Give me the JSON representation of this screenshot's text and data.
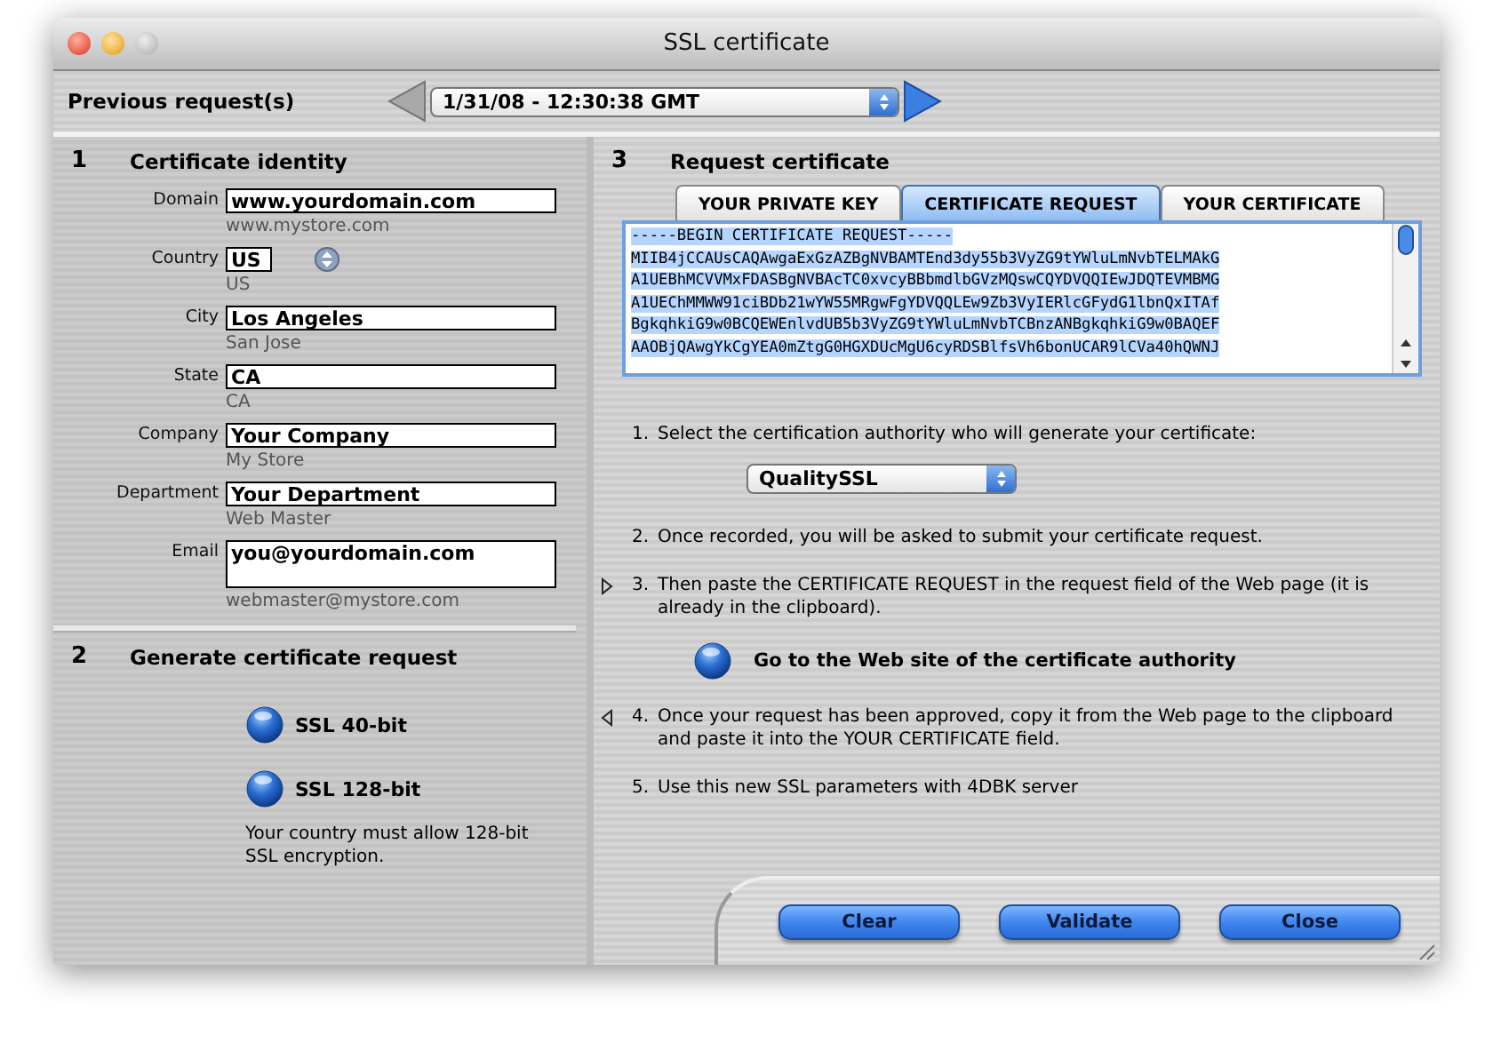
{
  "window": {
    "title": "SSL certificate"
  },
  "previous_requests": {
    "label": "Previous request(s)",
    "value": "1/31/08 - 12:30:38 GMT"
  },
  "identity": {
    "number": "1",
    "title": "Certificate identity",
    "fields": [
      {
        "label": "Domain",
        "value": "www.yourdomain.com",
        "example": "www.mystore.com",
        "kind": "text"
      },
      {
        "label": "Country",
        "value": "US",
        "example": "US",
        "kind": "stepper"
      },
      {
        "label": "City",
        "value": "Los Angeles",
        "example": "San Jose",
        "kind": "text"
      },
      {
        "label": "State",
        "value": "CA",
        "example": "CA",
        "kind": "text"
      },
      {
        "label": "Company",
        "value": "Your Company",
        "example": "My Store",
        "kind": "text"
      },
      {
        "label": "Department",
        "value": "Your Department",
        "example": "Web Master",
        "kind": "text"
      },
      {
        "label": "Email",
        "value": "you@yourdomain.com",
        "example": "webmaster@mystore.com",
        "kind": "multiline"
      }
    ]
  },
  "generate": {
    "number": "2",
    "title": "Generate certificate request",
    "options": [
      "SSL 40-bit",
      "SSL 128-bit"
    ],
    "note": "Your country must allow 128-bit SSL encryption."
  },
  "request": {
    "number": "3",
    "title": "Request certificate",
    "tabs": [
      {
        "label": "YOUR PRIVATE KEY",
        "selected": false
      },
      {
        "label": "CERTIFICATE REQUEST",
        "selected": true
      },
      {
        "label": "YOUR CERTIFICATE",
        "selected": false
      }
    ],
    "certificate_lines": [
      "-----BEGIN CERTIFICATE REQUEST-----",
      "MIIB4jCCAUsCAQAwgaExGzAZBgNVBAMTEnd3dy55b3VyZG9tYWluLmNvbTELMAkG",
      "A1UEBhMCVVMxFDASBgNVBAcTC0xvcyBBbmdlbGVzMQswCQYDVQQIEwJDQTEVMBMG",
      "A1UEChMMWW91ciBDb21wYW55MRgwFgYDVQQLEw9Zb3VyIERlcGFydG1lbnQxITAf",
      "BgkqhkiG9w0BCQEWEnlvdUB5b3VyZG9tYWluLmNvbTCBnzANBgkqhkiG9w0BAQEF",
      "AAOBjQAwgYkCgYEA0mZtgG0HGXDUcMgU6cyRDSBlfsVh6bonUCAR9lCVa40hQWNJ"
    ],
    "steps": [
      {
        "number": "1.",
        "text": "Select the certification authority who will generate your certificate:",
        "forward_marker": false,
        "back_marker": false,
        "select": "QualitySSL"
      },
      {
        "number": "2.",
        "text": "Once recorded, you will be asked to submit your certificate request.",
        "forward_marker": false,
        "back_marker": false
      },
      {
        "number": "3.",
        "text": "Then paste the CERTIFICATE REQUEST in the request field of the Web page (it is already in the clipboard).",
        "forward_marker": true,
        "back_marker": false,
        "button": "Go to the Web site of the certificate authority"
      },
      {
        "number": "4.",
        "text": "Once your request has been approved, copy it from the Web page to the clipboard and paste it into the YOUR CERTIFICATE field.",
        "forward_marker": false,
        "back_marker": true
      },
      {
        "number": "5.",
        "text": "Use this new SSL parameters with 4DBK server",
        "forward_marker": false,
        "back_marker": false
      }
    ]
  },
  "buttons": [
    "Clear",
    "Validate",
    "Close"
  ]
}
